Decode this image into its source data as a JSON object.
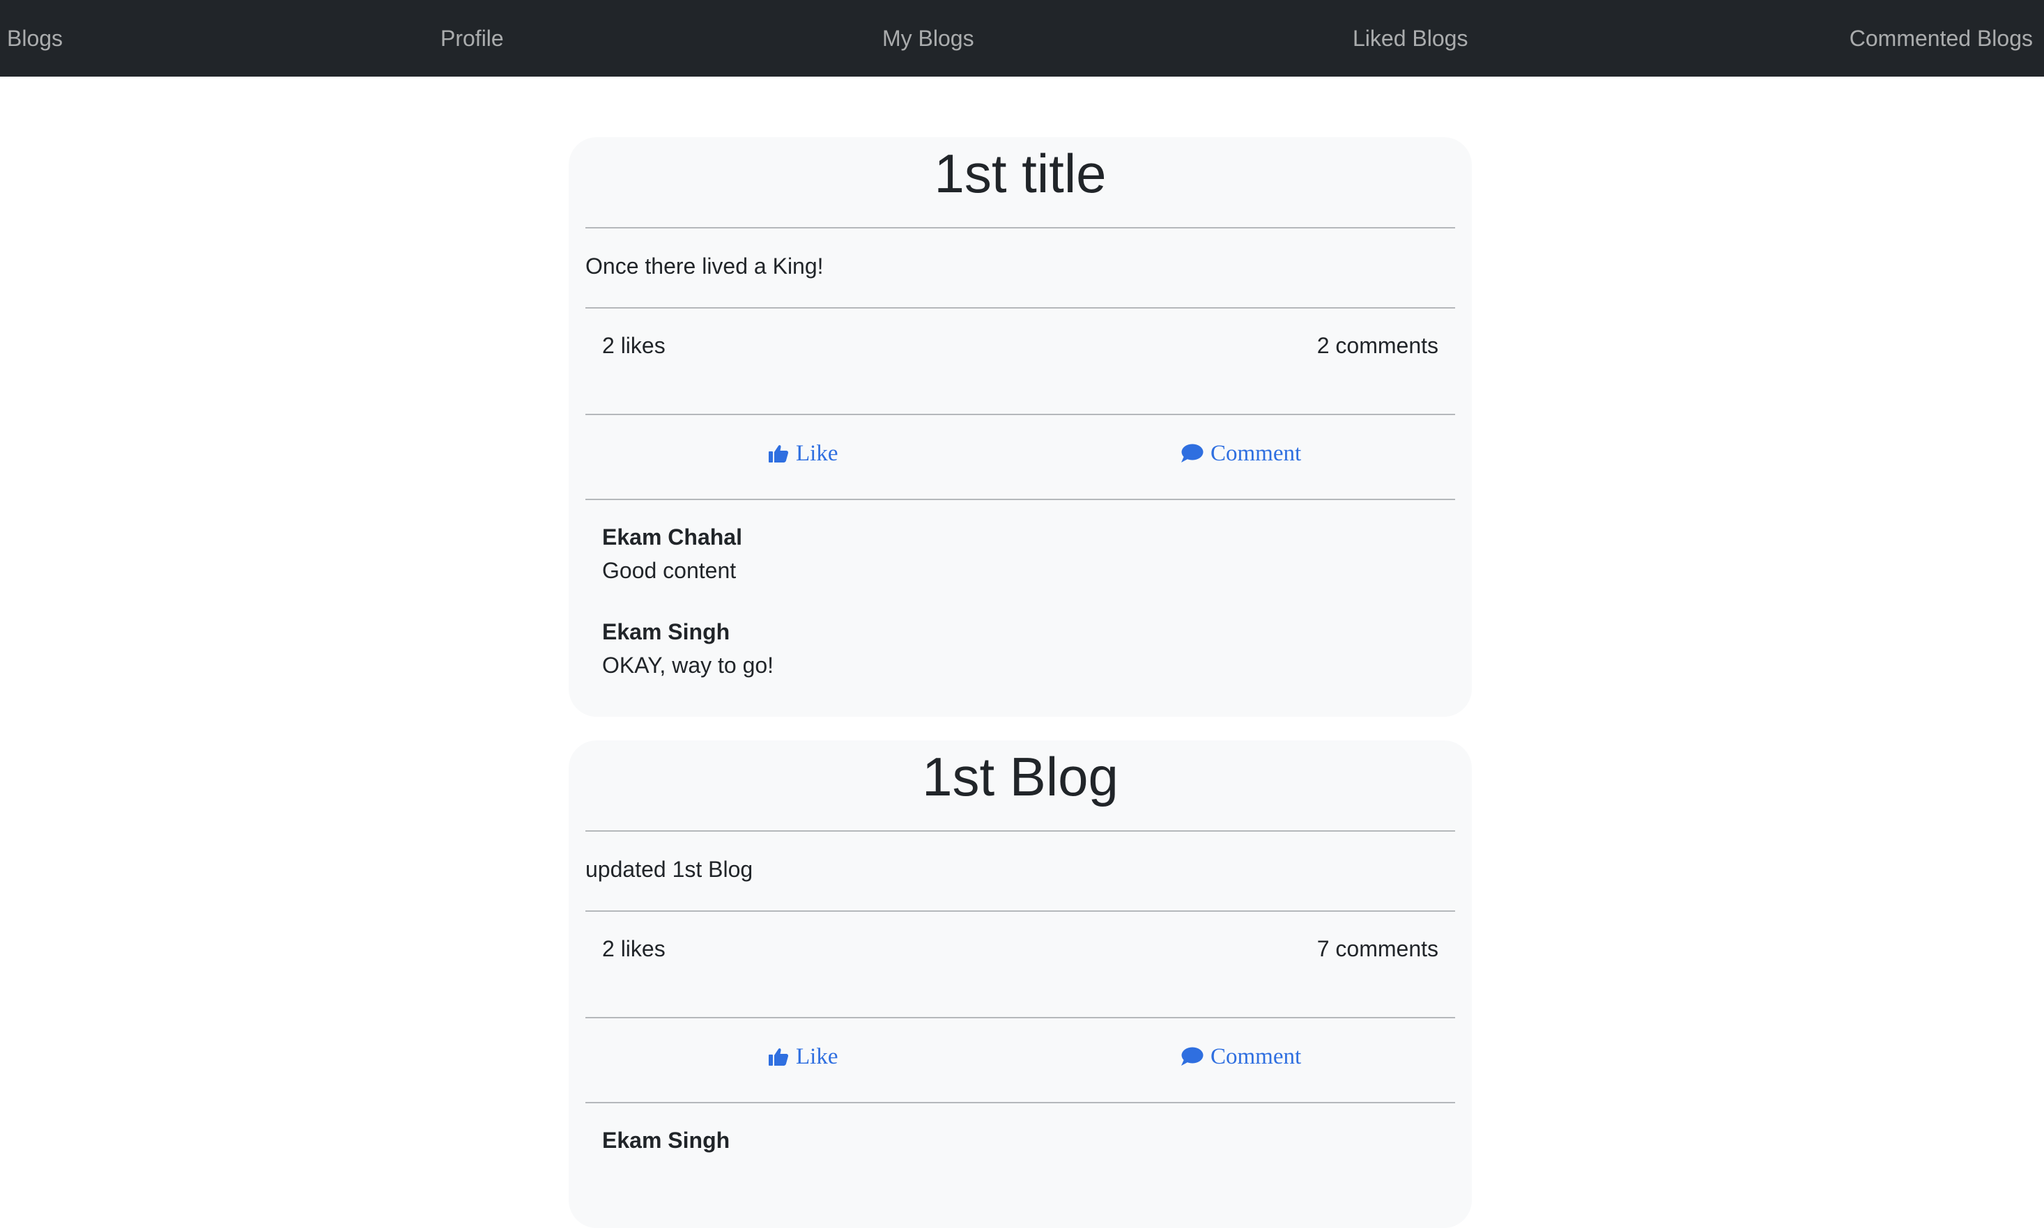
{
  "nav": {
    "blogs": "Blogs",
    "profile": "Profile",
    "my_blogs": "My Blogs",
    "liked_blogs": "Liked Blogs",
    "commented_blogs": "Commented Blogs"
  },
  "colors": {
    "navbar_bg": "#212529",
    "card_bg": "#f8f9fa",
    "action_blue": "#2f6fe0"
  },
  "blogs": [
    {
      "title": "1st title",
      "content": "Once there lived a King!",
      "likes": "2 likes",
      "comments_count": "2 comments",
      "like_label": "Like",
      "comment_label": "Comment",
      "like_icon": "thumbs-up-icon",
      "comment_icon": "speech-bubble-icon",
      "comments": [
        {
          "author": "Ekam Chahal",
          "text": "Good content"
        },
        {
          "author": "Ekam Singh",
          "text": "OKAY, way to go!"
        }
      ]
    },
    {
      "title": "1st Blog",
      "content": "updated 1st Blog",
      "likes": "2 likes",
      "comments_count": "7 comments",
      "like_label": "Like",
      "comment_label": "Comment",
      "like_icon": "thumbs-up-icon",
      "comment_icon": "speech-bubble-icon",
      "comments": [
        {
          "author": "Ekam Singh"
        }
      ]
    }
  ]
}
